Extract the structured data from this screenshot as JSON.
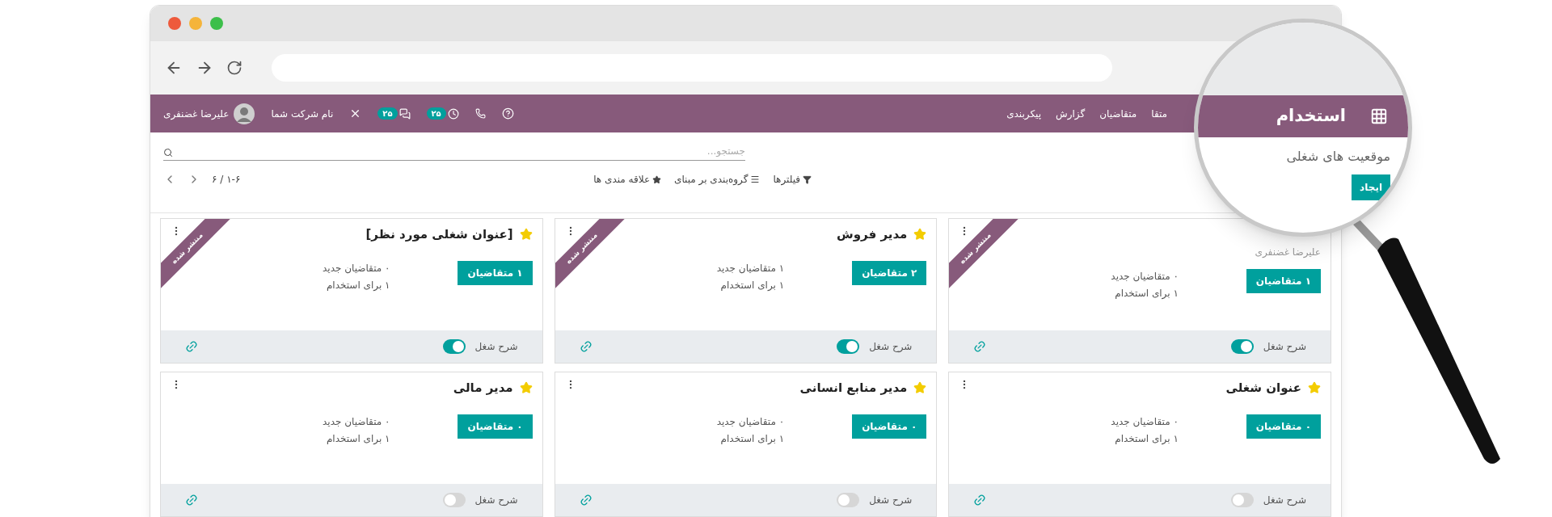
{
  "navbar": {
    "menu": [
      "متقا",
      "متقاضیان",
      "گزارش",
      "پیکربندی"
    ],
    "activity_badge": "۲۵",
    "chat_badge": "۲۵",
    "company": "نام شرکت شما",
    "user": "علیرضا غضنفری"
  },
  "magnifier": {
    "app_title": "استخدام",
    "breadcrumb": "موقعیت های شغلی",
    "create_button": "ایجاد"
  },
  "search": {
    "placeholder": "جستجو..."
  },
  "filters": [
    "فیلترها",
    "گروه‌بندی بر مبنای",
    "علاقه مندی ها"
  ],
  "pager": "۱-۶ / ۶",
  "cards": [
    {
      "subtitle": "علیرضا غضنفری",
      "ribbon": "منتشر شده",
      "applicants_button": "۱ متقاضیان",
      "new_applicants": "۰ متقاضیان جدید",
      "to_hire": "۱ برای استخدام",
      "description_label": "شرح شغل",
      "on": true
    },
    {
      "title": "مدیر فروش",
      "starred": true,
      "ribbon": "منتشر شده",
      "applicants_button": "۲ متقاضیان",
      "new_applicants": "۱ متقاضیان جدید",
      "to_hire": "۱ برای استخدام",
      "description_label": "شرح شغل",
      "on": true
    },
    {
      "title": "[عنوان شغلی مورد نظر]",
      "starred": true,
      "ribbon": "منتشر شده",
      "applicants_button": "۱ متقاضیان",
      "new_applicants": "۰ متقاضیان جدید",
      "to_hire": "۱ برای استخدام",
      "description_label": "شرح شغل",
      "on": true
    },
    {
      "title": "عنوان شغلی",
      "starred": true,
      "applicants_button": "۰ متقاضیان",
      "new_applicants": "۰ متقاضیان جدید",
      "to_hire": "۱ برای استخدام",
      "description_label": "شرح شغل",
      "on": false
    },
    {
      "title": "مدیر منابع انسانی",
      "starred": true,
      "applicants_button": "۰ متقاضیان",
      "new_applicants": "۰ متقاضیان جدید",
      "to_hire": "۱ برای استخدام",
      "description_label": "شرح شغل",
      "on": false
    },
    {
      "title": "مدیر مالی",
      "starred": true,
      "applicants_button": "۰ متقاضیان",
      "new_applicants": "۰ متقاضیان جدید",
      "to_hire": "۱ برای استخدام",
      "description_label": "شرح شغل",
      "on": false
    }
  ]
}
